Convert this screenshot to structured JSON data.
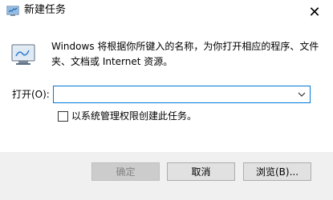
{
  "window": {
    "title": "新建任务",
    "close_glyph": "✕"
  },
  "content": {
    "description": "Windows 将根据你所键入的名称，为你打开相应的程序、文件夹、文档或 Internet 资源。",
    "icon": "run-dialog-icon"
  },
  "open_field": {
    "label": "打开(O):",
    "value": "",
    "placeholder": ""
  },
  "admin_option": {
    "label": "以系统管理权限创建此任务。",
    "checked": false
  },
  "buttons": {
    "ok": "确定",
    "cancel": "取消",
    "browse": "浏览(B)..."
  },
  "colors": {
    "accent": "#0078d7",
    "footer_bg": "#f0f0f0",
    "button_bg": "#e1e1e1",
    "disabled_text": "#838383"
  }
}
